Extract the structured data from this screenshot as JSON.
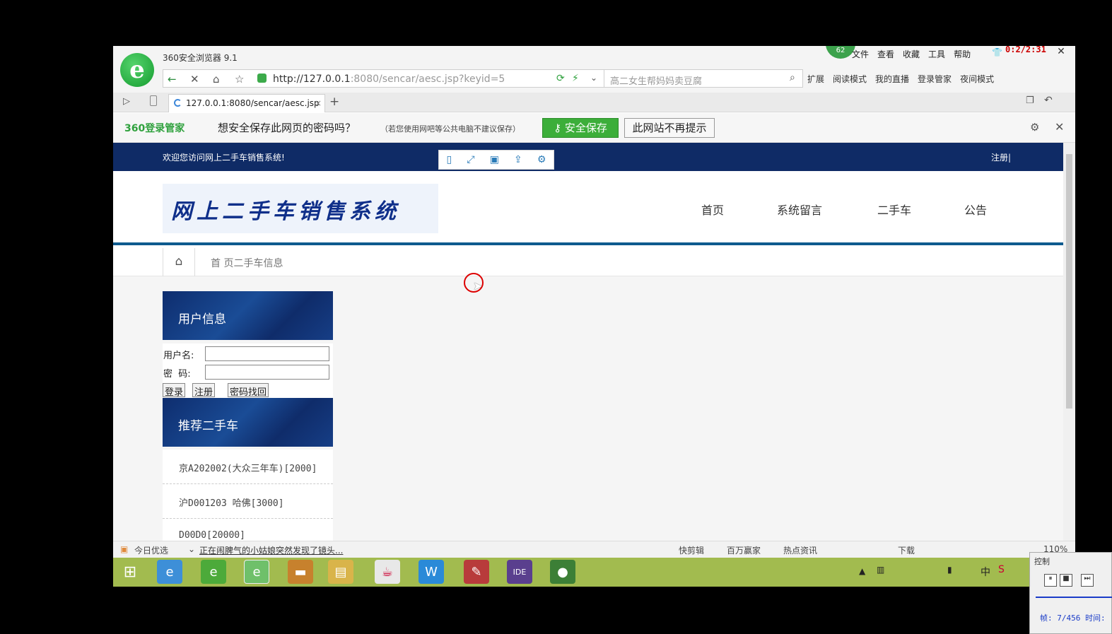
{
  "browser": {
    "title": "360安全浏览器 9.1",
    "badge": "62",
    "menu": [
      "文件",
      "查看",
      "收藏",
      "工具",
      "帮助"
    ],
    "timer": "0:2/2:31",
    "url_host": "http://127.0.0.1",
    "url_rest": ":8080/sencar/aesc.jsp?keyid=5",
    "search_placeholder": "高二女生帮妈妈卖豆腐",
    "toolbar": [
      "扩展",
      "阅读模式",
      "我的直播",
      "登录管家",
      "夜间模式"
    ],
    "tab_title": "127.0.0.1:8080/sencar/aesc.jsp"
  },
  "pwbar": {
    "logo": "360登录管家",
    "question": "想安全保存此网页的密码吗？",
    "note": "（若您使用网吧等公共电脑不建议保存）",
    "save": "安全保存",
    "never": "此网站不再提示"
  },
  "site": {
    "welcome": "欢迎您访问网上二手车销售系统!",
    "register_link": "注册|",
    "logo_text": "网上二手车销售系统",
    "nav": [
      "首页",
      "系统留言",
      "二手车",
      "公告"
    ],
    "breadcrumb": "首  页二手车信息"
  },
  "login": {
    "heading": "用户信息",
    "user_label": "用户名:",
    "pass_label": "密  码:",
    "login_btn": "登录",
    "register_btn": "注册",
    "recover_btn": "密码找回"
  },
  "cars": {
    "heading": "推荐二手车",
    "items": [
      "京A202002(大众三年车)[2000]",
      "沪D001203 哈佛[3000]",
      "D00D0[20000]"
    ]
  },
  "statusbar": {
    "left": "今日优选",
    "news": "正在闹脾气的小姑娘突然发现了镜头...",
    "right": [
      "快剪辑",
      "百万赢家",
      "热点资讯",
      "下载",
      "110%"
    ]
  },
  "tray": {
    "ime": "中"
  },
  "control": {
    "title": "控制",
    "frame": "帧: 7/456 时间:"
  }
}
